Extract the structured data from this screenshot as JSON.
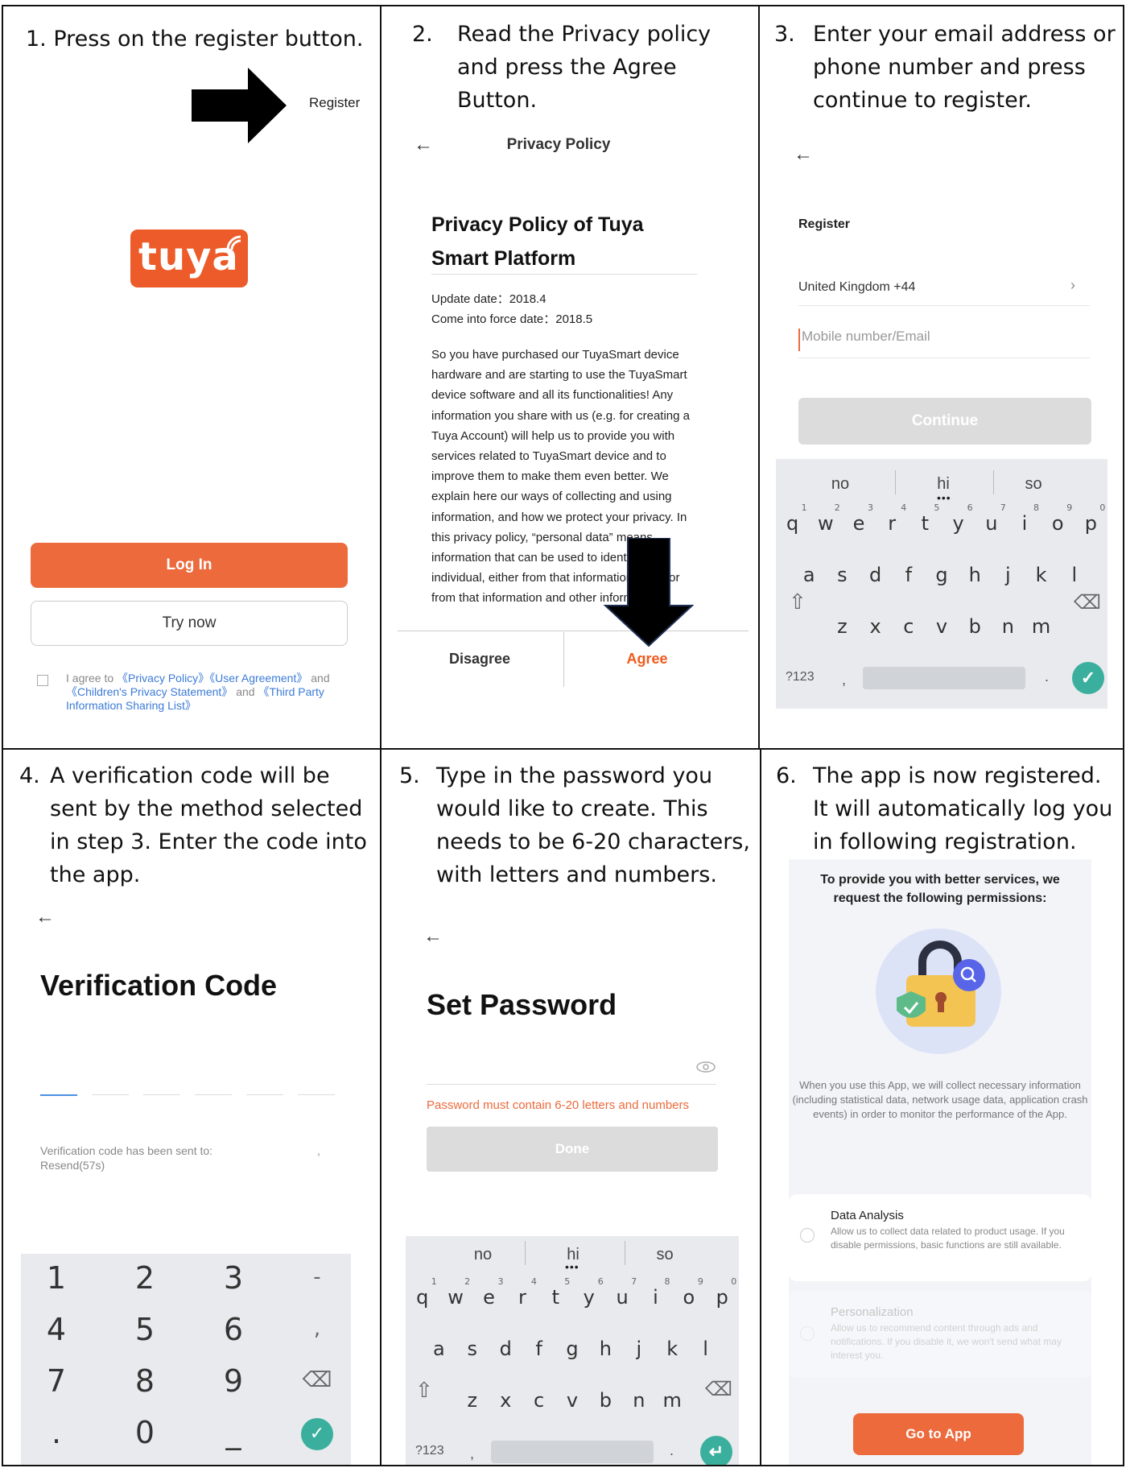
{
  "step1": {
    "instruction": "1. Press on the register button.",
    "register_label": "Register",
    "logo_text": "tuya",
    "login_label": "Log In",
    "try_now_label": "Try now",
    "agree_text_1": "I agree to ",
    "privacy_link": "《Privacy Policy》",
    "user_agreement_link": "《User Agreement》",
    "and_1": "and ",
    "children_link": "《Children's Privacy Statement》",
    "and_2": " and ",
    "third_party_link": "《Third Party Information Sharing List》"
  },
  "step2": {
    "number": "2.",
    "instruction": "Read the Privacy policy and press the Agree Button.",
    "header_title": "Privacy Policy",
    "policy_title": "Privacy Policy of Tuya Smart Platform",
    "update_date": "Update date：2018.4",
    "force_date": "Come into force date：2018.5",
    "body": "So you have purchased our TuyaSmart device hardware and are starting to use the TuyaSmart device software and all its functionalities! Any information you share with us (e.g. for creating a Tuya Account) will help us to provide you with services related to TuyaSmart device and to improve them to make them even better. We explain here our ways of collecting and using information, and how we protect your privacy. In this privacy policy, “personal data” means information that can be used to identify an individual, either from that information alone or from that information and other information",
    "disagree_label": "Disagree",
    "agree_label": "Agree"
  },
  "step3": {
    "number": "3.",
    "instruction": "Enter your email address or phone number and press continue to register.",
    "heading": "Register",
    "country": "United Kingdom +44",
    "input_placeholder": "Mobile number/Email",
    "continue_label": "Continue",
    "suggestions": [
      "no",
      "hi",
      "so"
    ],
    "row1": [
      "q",
      "w",
      "e",
      "r",
      "t",
      "y",
      "u",
      "i",
      "o",
      "p"
    ],
    "row1_nums": [
      "1",
      "2",
      "3",
      "4",
      "5",
      "6",
      "7",
      "8",
      "9",
      "0"
    ],
    "row2": [
      "a",
      "s",
      "d",
      "f",
      "g",
      "h",
      "j",
      "k",
      "l"
    ],
    "row3": [
      "z",
      "x",
      "c",
      "v",
      "b",
      "n",
      "m"
    ],
    "sym_label": "?123",
    "comma": ",",
    "period": "."
  },
  "step4": {
    "number": "4.",
    "instruction": "A verification code will be sent by the method selected in step 3.  Enter the code into the app.",
    "heading": "Verification Code",
    "sent_to": "Verification code has been sent to:",
    "resend": "Resend(57s)",
    "sent_comma": ",",
    "numpad": [
      "1",
      "2",
      "3",
      "-",
      "4",
      "5",
      "6",
      ",",
      "7",
      "8",
      "9",
      "⌫",
      ".",
      "0",
      "_",
      "✓"
    ]
  },
  "step5": {
    "number": "5.",
    "instruction": "Type in the password you would like to create.  This needs to be 6-20 characters, with letters and numbers.",
    "heading": "Set Password",
    "hint": "Password must contain 6-20 letters and numbers",
    "done_label": "Done",
    "suggestions": [
      "no",
      "hi",
      "so"
    ],
    "row1": [
      "q",
      "w",
      "e",
      "r",
      "t",
      "y",
      "u",
      "i",
      "o",
      "p"
    ],
    "row1_nums": [
      "1",
      "2",
      "3",
      "4",
      "5",
      "6",
      "7",
      "8",
      "9",
      "0"
    ],
    "row2": [
      "a",
      "s",
      "d",
      "f",
      "g",
      "h",
      "j",
      "k",
      "l"
    ],
    "row3": [
      "z",
      "x",
      "c",
      "v",
      "b",
      "n",
      "m"
    ],
    "sym_label": "?123",
    "comma": ",",
    "period": "."
  },
  "step6": {
    "number": "6.",
    "instruction": "The app is now registered.  It will automatically log you in following registration.",
    "perm_title": "To provide you with better services, we request the following permissions:",
    "perm_body": "When you use this App, we will collect necessary information (including statistical data, network usage data, application crash events) in order to monitor the performance of the App.",
    "data_analysis_title": "Data Analysis",
    "data_analysis_body": "Allow us to collect data related to product usage. If you disable permissions, basic functions are still available.",
    "personalization_title": "Personalization",
    "personalization_body": "Allow us to recommend content through ads and notifications. If you disable it, we won't send what may interest you.",
    "go_label": "Go to App"
  },
  "colors": {
    "accent": "#ec6a3c",
    "link": "#3b7ad8",
    "teal": "#3aaf9d",
    "agree_text": "#f05a1e"
  }
}
